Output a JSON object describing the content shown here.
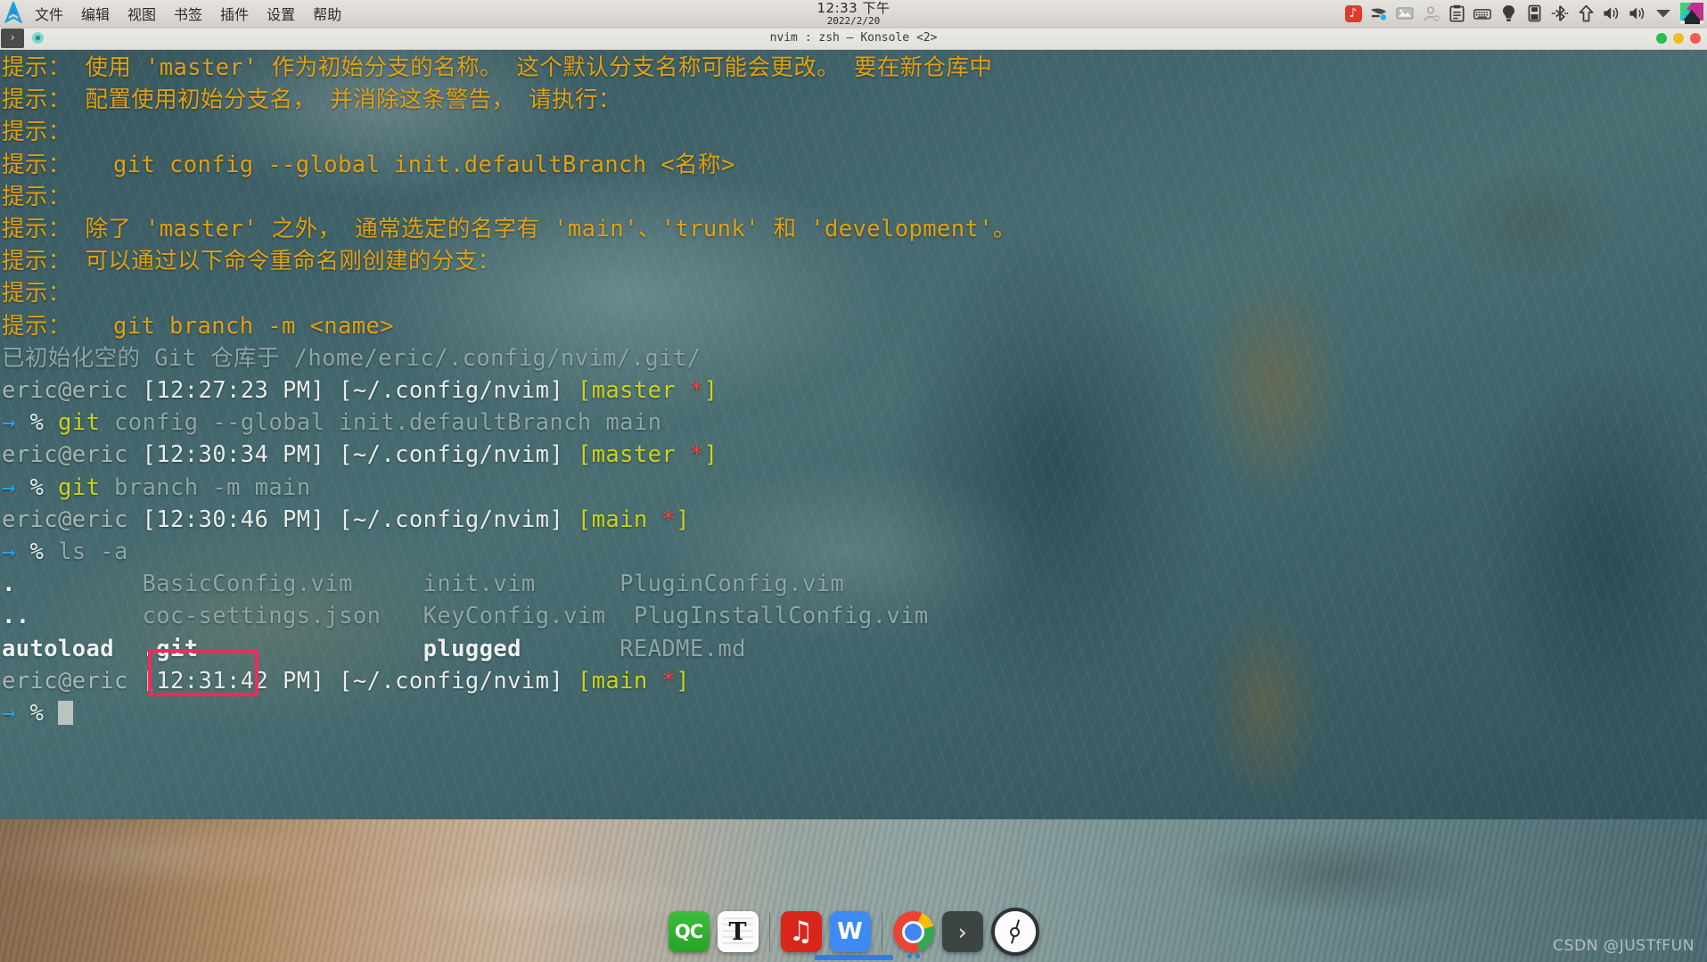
{
  "topbar": {
    "logo_icon": "arch-linux-logo",
    "menu": [
      {
        "label": "文件"
      },
      {
        "label": "编辑"
      },
      {
        "label": "视图"
      },
      {
        "label": "书签"
      },
      {
        "label": "插件"
      },
      {
        "label": "设置"
      },
      {
        "label": "帮助"
      }
    ],
    "clock": {
      "time": "12:33  下午",
      "date": "2022/2/20"
    },
    "tray": [
      {
        "name": "netease-music-tray-icon",
        "glyph": "♫"
      },
      {
        "name": "fcitx-input-method-icon",
        "glyph": "✒"
      },
      {
        "name": "image-viewer-tray-icon",
        "glyph": "⛰"
      },
      {
        "name": "user-status-icon",
        "glyph": "☺"
      },
      {
        "name": "clipboard-icon",
        "glyph": "📋"
      },
      {
        "name": "keyboard-layout-icon",
        "glyph": "⌨"
      },
      {
        "name": "notification-bulb-icon",
        "glyph": "💡"
      },
      {
        "name": "removable-media-icon",
        "glyph": "💾"
      },
      {
        "name": "bluetooth-icon",
        "glyph": "ᛦ"
      },
      {
        "name": "updates-arrow-icon",
        "glyph": "⇧"
      },
      {
        "name": "volume-icon",
        "glyph": "🔊"
      },
      {
        "name": "microphone-volume-icon",
        "glyph": "🔊"
      },
      {
        "name": "show-hidden-tray-icon",
        "glyph": "▼"
      },
      {
        "name": "desktop-switcher-icon",
        "glyph": ""
      }
    ]
  },
  "window": {
    "title": "nvim : zsh — Konsole <2>",
    "tab_icon": "terminal-prompt-icon",
    "tab_indicator": "session-active-dot",
    "buttons": {
      "minimize": "minimize-button",
      "maximize": "maximize-button",
      "close": "close-button"
    }
  },
  "terminal": {
    "lines": [
      {
        "id": "l1",
        "segs": [
          {
            "t": "提示： 使用 'master' 作为初始分支的名称。 这个默认分支名称可能会更改。 要在新仓库中",
            "c": "hint"
          }
        ]
      },
      {
        "id": "l2",
        "segs": [
          {
            "t": "提示： 配置使用初始分支名， 并消除这条警告， 请执行：",
            "c": "hint"
          }
        ]
      },
      {
        "id": "l3",
        "segs": [
          {
            "t": "提示：",
            "c": "hint"
          }
        ]
      },
      {
        "id": "l4",
        "segs": [
          {
            "t": "提示：   git config --global init.defaultBranch <名称>",
            "c": "hint"
          }
        ]
      },
      {
        "id": "l5",
        "segs": [
          {
            "t": "提示：",
            "c": "hint"
          }
        ]
      },
      {
        "id": "l6",
        "segs": [
          {
            "t": "提示： 除了 'master' 之外， 通常选定的名字有 'main'、'trunk' 和 'development'。",
            "c": "hint"
          }
        ]
      },
      {
        "id": "l7",
        "segs": [
          {
            "t": "提示： 可以通过以下命令重命名刚创建的分支：",
            "c": "hint"
          }
        ]
      },
      {
        "id": "l8",
        "segs": [
          {
            "t": "提示：",
            "c": "hint"
          }
        ]
      },
      {
        "id": "l9",
        "segs": [
          {
            "t": "提示：   git branch -m <name>",
            "c": "hint"
          }
        ]
      },
      {
        "id": "l10",
        "segs": [
          {
            "t": "已初始化空的 Git 仓库于 /home/eric/.config/nvim/.git/",
            "c": "dim"
          }
        ]
      },
      {
        "id": "l11",
        "segs": [
          {
            "t": "eric@eric ",
            "c": "gray"
          },
          {
            "t": "[12:27:23 PM] [~/.config/nvim] ",
            "c": "white"
          },
          {
            "t": "[master ",
            "c": "yellow"
          },
          {
            "t": "*",
            "c": "red"
          },
          {
            "t": "]",
            "c": "yellow"
          }
        ]
      },
      {
        "id": "l12",
        "segs": [
          {
            "t": "→ ",
            "c": "blue"
          },
          {
            "t": "% ",
            "c": "white"
          },
          {
            "t": "git ",
            "c": "yellow"
          },
          {
            "t": "config --global init.defaultBranch main",
            "c": "dim"
          }
        ]
      },
      {
        "id": "l13",
        "segs": [
          {
            "t": "eric@eric ",
            "c": "gray"
          },
          {
            "t": "[12:30:34 PM] [~/.config/nvim] ",
            "c": "white"
          },
          {
            "t": "[master ",
            "c": "yellow"
          },
          {
            "t": "*",
            "c": "red"
          },
          {
            "t": "]",
            "c": "yellow"
          }
        ]
      },
      {
        "id": "l14",
        "segs": [
          {
            "t": "→ ",
            "c": "blue"
          },
          {
            "t": "% ",
            "c": "white"
          },
          {
            "t": "git ",
            "c": "yellow"
          },
          {
            "t": "branch -m main",
            "c": "dim"
          }
        ]
      },
      {
        "id": "l15",
        "segs": [
          {
            "t": "eric@eric ",
            "c": "gray"
          },
          {
            "t": "[12:30:46 PM] [~/.config/nvim] ",
            "c": "white"
          },
          {
            "t": "[main ",
            "c": "yellow"
          },
          {
            "t": "*",
            "c": "red"
          },
          {
            "t": "]",
            "c": "yellow"
          }
        ]
      },
      {
        "id": "l16",
        "segs": [
          {
            "t": "→ ",
            "c": "blue"
          },
          {
            "t": "% ",
            "c": "white"
          },
          {
            "t": "ls ",
            "c": "dim"
          },
          {
            "t": "-a",
            "c": "dim"
          }
        ]
      },
      {
        "id": "l17",
        "segs": [
          {
            "t": ".         ",
            "c": "bold"
          },
          {
            "t": "BasicConfig.vim     init.vim      PluginConfig.vim",
            "c": "dim"
          }
        ]
      },
      {
        "id": "l18",
        "segs": [
          {
            "t": "..        ",
            "c": "bold"
          },
          {
            "t": "coc-settings.json   KeyConfig.vim  PlugInstallConfig.vim",
            "c": "dim"
          }
        ]
      },
      {
        "id": "l19",
        "segs": [
          {
            "t": "autoload  .git                ",
            "c": "bold"
          },
          {
            "t": "plugged       ",
            "c": "bold"
          },
          {
            "t": "README.md",
            "c": "dim"
          }
        ]
      },
      {
        "id": "l20",
        "segs": [
          {
            "t": "eric@eric ",
            "c": "gray"
          },
          {
            "t": "[12:31:42 PM] [~/.config/nvim] ",
            "c": "white"
          },
          {
            "t": "[main ",
            "c": "yellow"
          },
          {
            "t": "*",
            "c": "red"
          },
          {
            "t": "]",
            "c": "yellow"
          }
        ]
      },
      {
        "id": "l21",
        "segs": [
          {
            "t": "→ ",
            "c": "blue"
          },
          {
            "t": "% ",
            "c": "white"
          }
        ],
        "cursor": true
      }
    ],
    "annotation": {
      "name": "git-folder-highlight",
      "target": ".git",
      "color": "#f6285a"
    }
  },
  "dock": {
    "items": [
      {
        "name": "dock-item-qc",
        "label": "QC",
        "kind": "qc"
      },
      {
        "name": "dock-item-typora",
        "label": "T",
        "kind": "typora"
      },
      {
        "name": "dock-separator-1",
        "label": "",
        "kind": "sep"
      },
      {
        "name": "dock-item-netease-music",
        "label": "♫",
        "kind": "nem"
      },
      {
        "name": "dock-item-wps-writer",
        "label": "W",
        "kind": "wps"
      },
      {
        "name": "dock-separator-2",
        "label": "",
        "kind": "sep"
      },
      {
        "name": "dock-item-google-chrome",
        "label": "",
        "kind": "chrome"
      },
      {
        "name": "dock-item-konsole",
        "label": "›",
        "kind": "konsole-ico"
      },
      {
        "name": "dock-item-clock",
        "label": "",
        "kind": "clockapp"
      }
    ]
  },
  "watermark": {
    "text": "CSDN @JUSTfFUN"
  },
  "colors": {
    "hint": "#e0a113",
    "branch": "#cbd41b",
    "dirty_star": "#f0453c",
    "prompt_arrow": "#27a3ee",
    "annotation": "#f6285a",
    "terminal_dim": "#8fa6a8"
  }
}
